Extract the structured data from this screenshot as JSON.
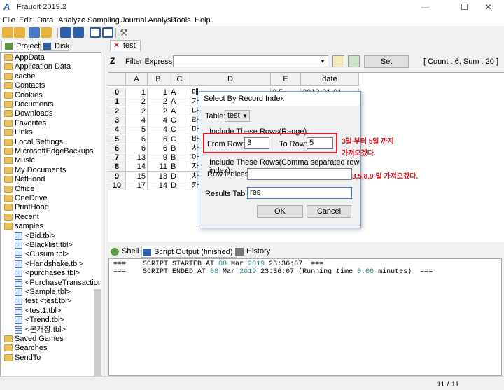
{
  "window": {
    "title": "Fraudit 2019.2",
    "minimize": "—",
    "maximize": "☐",
    "close": "✕"
  },
  "menu": [
    "File",
    "Edit",
    "Data",
    "Analyze",
    "Sampling",
    "Journal Analysis",
    "Tools",
    "Help"
  ],
  "left_tabs": {
    "project": "Project",
    "disk": "Disk"
  },
  "tree": [
    {
      "label": "AppData",
      "kind": "folder"
    },
    {
      "label": "Application Data",
      "kind": "folder"
    },
    {
      "label": "cache",
      "kind": "folder"
    },
    {
      "label": "Contacts",
      "kind": "folder"
    },
    {
      "label": "Cookies",
      "kind": "folder"
    },
    {
      "label": "Documents",
      "kind": "folder"
    },
    {
      "label": "Downloads",
      "kind": "folder"
    },
    {
      "label": "Favorites",
      "kind": "folder"
    },
    {
      "label": "Links",
      "kind": "folder"
    },
    {
      "label": "Local Settings",
      "kind": "folder"
    },
    {
      "label": "MicrosoftEdgeBackups",
      "kind": "folder"
    },
    {
      "label": "Music",
      "kind": "folder"
    },
    {
      "label": "My Documents",
      "kind": "folder"
    },
    {
      "label": "NetHood",
      "kind": "folder"
    },
    {
      "label": "Office",
      "kind": "folder"
    },
    {
      "label": "OneDrive",
      "kind": "folder"
    },
    {
      "label": "PrintHood",
      "kind": "folder"
    },
    {
      "label": "Recent",
      "kind": "folder"
    },
    {
      "label": "samples",
      "kind": "folder"
    },
    {
      "label": "<Bid.tbl>",
      "kind": "table"
    },
    {
      "label": "<Blacklist.tbl>",
      "kind": "table"
    },
    {
      "label": "<Cusum.tbl>",
      "kind": "table"
    },
    {
      "label": "<Handshake.tbl>",
      "kind": "table"
    },
    {
      "label": "<purchases.tbl>",
      "kind": "table"
    },
    {
      "label": "<PurchaseTransaction.tb",
      "kind": "table"
    },
    {
      "label": "<Sample.tbl>",
      "kind": "table"
    },
    {
      "label": "test <test.tbl>",
      "kind": "table"
    },
    {
      "label": "<test1.tbl>",
      "kind": "table"
    },
    {
      "label": "<Trend.tbl>",
      "kind": "table"
    },
    {
      "label": "<본개장.tbl>",
      "kind": "table"
    },
    {
      "label": "Saved Games",
      "kind": "folder"
    },
    {
      "label": "Searches",
      "kind": "folder"
    },
    {
      "label": "SendTo",
      "kind": "folder"
    }
  ],
  "doc_tab": {
    "close": "✕",
    "label": "test"
  },
  "filter": {
    "label": "Filter Expression:",
    "value": "",
    "set_label": "Set",
    "count_text": "[ Count : 6, Sum : 20 ]"
  },
  "grid": {
    "columns": [
      "A",
      "B",
      "C",
      "D",
      "E",
      "date"
    ],
    "rows": [
      {
        "idx": "0",
        "A": "1",
        "B": "1",
        "C": "A",
        "D": "매",
        "E": "0.5",
        "date": "2019-01-01"
      },
      {
        "idx": "1",
        "A": "2",
        "B": "2",
        "C": "A",
        "D": "가",
        "E": "",
        "date": ""
      },
      {
        "idx": "2",
        "A": "2",
        "B": "2",
        "C": "A",
        "D": "나",
        "E": "",
        "date": ""
      },
      {
        "idx": "3",
        "A": "4",
        "B": "4",
        "C": "C",
        "D": "라",
        "E": "",
        "date": ""
      },
      {
        "idx": "4",
        "A": "5",
        "B": "4",
        "C": "C",
        "D": "마",
        "E": "",
        "date": ""
      },
      {
        "idx": "5",
        "A": "6",
        "B": "6",
        "C": "C",
        "D": "바",
        "E": "",
        "date": ""
      },
      {
        "idx": "6",
        "A": "6",
        "B": "6",
        "C": "B",
        "D": "사",
        "E": "",
        "date": ""
      },
      {
        "idx": "7",
        "A": "13",
        "B": "9",
        "C": "B",
        "D": "아",
        "E": "",
        "date": ""
      },
      {
        "idx": "8",
        "A": "14",
        "B": "11",
        "C": "B",
        "D": "자",
        "E": "",
        "date": ""
      },
      {
        "idx": "9",
        "A": "15",
        "B": "13",
        "C": "D",
        "D": "차",
        "E": "",
        "date": ""
      },
      {
        "idx": "10",
        "A": "17",
        "B": "14",
        "C": "D",
        "D": "카",
        "E": "",
        "date": ""
      }
    ]
  },
  "bottom_tabs": {
    "shell": "Shell",
    "script": "Script Output (finished)",
    "history": "History"
  },
  "console": {
    "line1_prefix": "===    SCRIPT STARTED AT ",
    "line1_day": "08",
    "line1_mid": " Mar ",
    "line1_year": "2019",
    "line1_time": " 23:36:07",
    "line1_suffix": "  ===",
    "line2_prefix": "===    SCRIPT ENDED AT ",
    "line2_day": "08",
    "line2_mid": " Mar ",
    "line2_year": "2019",
    "line2_time": " 23:36:07",
    "line2_run": " (Running time ",
    "line2_secs": "0.00",
    "line2_suffix": " minutes)  ==="
  },
  "status": {
    "page": "11 / 11"
  },
  "dialog": {
    "title": "Select By Record Index",
    "table_label": "Table:",
    "table_value": "test",
    "range_group": "Include These Rows(Range):",
    "from_label": "From Row:",
    "from_value": "3",
    "to_label": "To Row:",
    "to_value": "5",
    "indices_group": "Include These Rows(Comma separated row index):",
    "indices_label": "Row indices:",
    "indices_value": "",
    "results_label": "Results Table:",
    "results_value": "res",
    "ok_label": "OK",
    "cancel_label": "Cancel"
  },
  "annotations": {
    "range_note_1": "3일 부터 5일 까지",
    "range_note_2": "가져오겠다.",
    "indices_note": "3,5,8,9 일 가져오겠다."
  },
  "colors": {
    "annotation": "#d0101a",
    "console_highlight": "#2a8a8a",
    "accent": "#1f5fb5"
  }
}
